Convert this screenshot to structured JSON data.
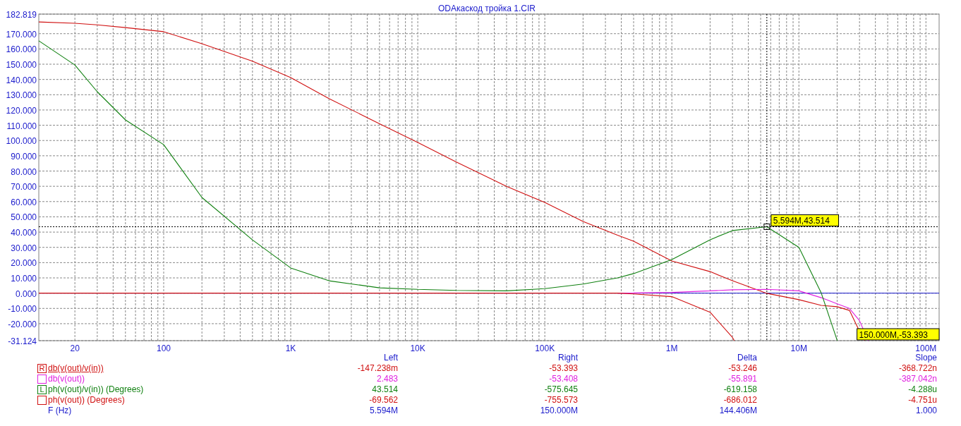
{
  "title": "ODAкаскод  тройка 1.CIR",
  "plot": {
    "y_labels": [
      "182.819",
      "170.000",
      "160.000",
      "150.000",
      "140.000",
      "130.000",
      "120.000",
      "110.000",
      "100.000",
      "90.000",
      "80.000",
      "70.000",
      "60.000",
      "50.000",
      "40.000",
      "30.000",
      "20.000",
      "10.000",
      "0.000",
      "-10.000",
      "-20.000",
      "-31.124"
    ],
    "x_labels": [
      "20",
      "100",
      "1K",
      "10K",
      "100K",
      "1M",
      "10M",
      "100M"
    ],
    "cursor_labels": [
      "5.594M,43.514",
      "150.000M,-53.393"
    ]
  },
  "legend": {
    "columns": [
      "Left",
      "Right",
      "Delta",
      "Slope"
    ],
    "rows": [
      {
        "kind": "series",
        "marker": "R",
        "label": "db(v(out)/v(in))",
        "color": "#d01010",
        "selected": true,
        "values": [
          "-147.238m",
          "-53.393",
          "-53.246",
          "-368.722n"
        ]
      },
      {
        "kind": "series",
        "label": "db(v(out))",
        "color": "#e020e0",
        "selected": false,
        "values": [
          "2.483",
          "-53.408",
          "-55.891",
          "-387.042n"
        ]
      },
      {
        "kind": "series",
        "marker": "L",
        "label": "ph(v(out)/v(in)) (Degrees)",
        "color": "#108010",
        "selected": false,
        "values": [
          "43.514",
          "-575.645",
          "-619.158",
          "-4.288u"
        ]
      },
      {
        "kind": "series",
        "label": "ph(v(out)) (Degrees)",
        "color": "#d01010",
        "selected": false,
        "values": [
          "-69.562",
          "-755.573",
          "-686.012",
          "-4.751u"
        ]
      },
      {
        "kind": "axis",
        "label": "F (Hz)",
        "color": "#1a1acc",
        "values": [
          "5.594M",
          "150.000M",
          "144.406M",
          "1.000"
        ]
      }
    ]
  }
}
